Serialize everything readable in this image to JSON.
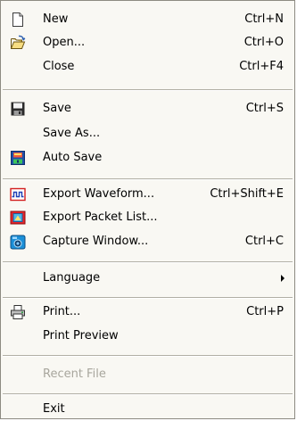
{
  "menu": {
    "items": [
      {
        "label": "New",
        "shortcut": "Ctrl+N",
        "icon": "new-document-icon"
      },
      {
        "label": "Open...",
        "shortcut": "Ctrl+O",
        "icon": "open-folder-icon"
      },
      {
        "label": "Close",
        "shortcut": "Ctrl+F4"
      },
      {
        "label": "Save",
        "shortcut": "Ctrl+S",
        "icon": "floppy-disk-icon"
      },
      {
        "label": "Save As...",
        "shortcut": ""
      },
      {
        "label": "Auto Save",
        "shortcut": "",
        "icon": "auto-save-icon"
      },
      {
        "label": "Export Waveform...",
        "shortcut": "Ctrl+Shift+E",
        "icon": "waveform-icon"
      },
      {
        "label": "Export Packet List...",
        "shortcut": "",
        "icon": "packet-list-icon"
      },
      {
        "label": "Capture Window...",
        "shortcut": "Ctrl+C",
        "icon": "camera-icon"
      },
      {
        "label": "Language",
        "shortcut": "",
        "submenu": true
      },
      {
        "label": "Print...",
        "shortcut": "Ctrl+P",
        "icon": "printer-icon"
      },
      {
        "label": "Print Preview",
        "shortcut": ""
      },
      {
        "label": "Recent File",
        "shortcut": "",
        "disabled": true
      },
      {
        "label": "Exit",
        "shortcut": ""
      }
    ]
  },
  "colors": {
    "menu_background": "#f9f8f3",
    "disabled_text": "#a8a69d",
    "separator": "#b1afa5"
  }
}
